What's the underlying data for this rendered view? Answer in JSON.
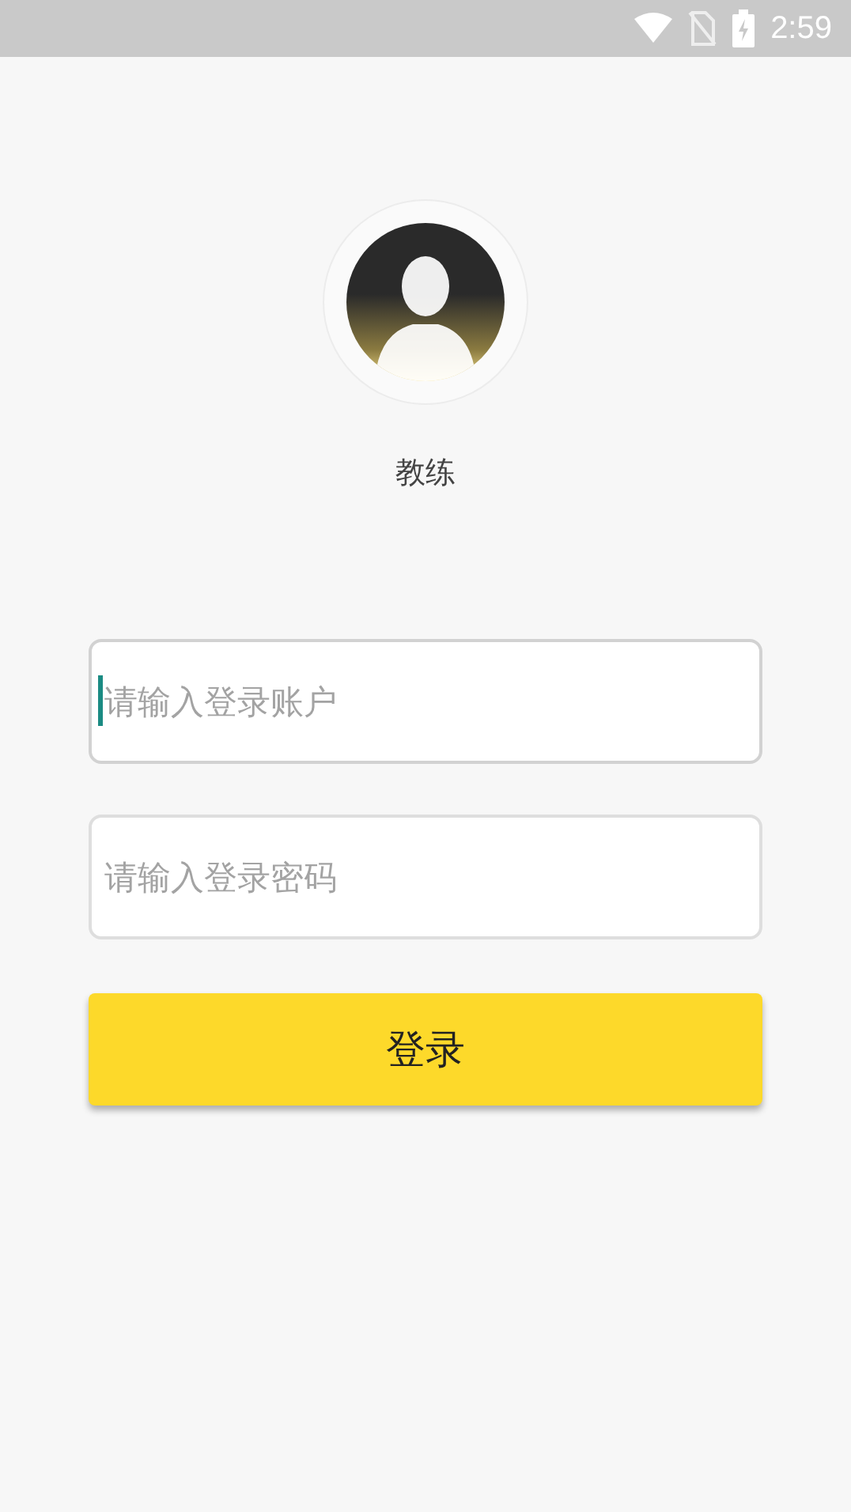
{
  "status_bar": {
    "time": "2:59"
  },
  "profile": {
    "role": "教练"
  },
  "fields": [
    {
      "placeholder": "请输入登录账户",
      "focused": true
    },
    {
      "placeholder": "请输入登录密码",
      "focused": false
    }
  ],
  "login_button": {
    "label": "登录"
  }
}
